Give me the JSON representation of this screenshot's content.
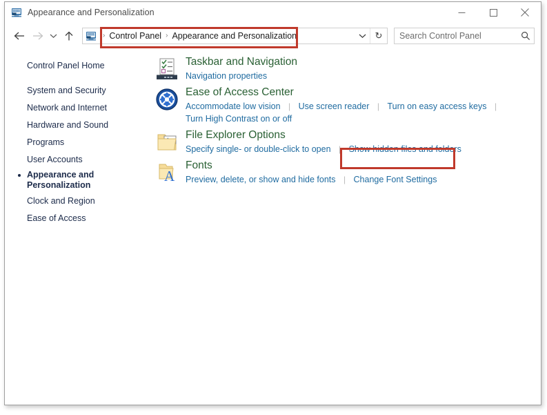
{
  "window": {
    "title": "Appearance and Personalization",
    "title_icon": "control-panel-icon",
    "caption": {
      "minimize": "minimize-icon",
      "maximize": "maximize-icon",
      "close": "close-icon"
    }
  },
  "navbar": {
    "back": "back-arrow-icon",
    "forward": "forward-arrow-icon",
    "recent": "recent-locations-chevron-icon",
    "up": "up-arrow-icon",
    "breadcrumb_icon": "control-panel-icon",
    "breadcrumb": [
      {
        "label": "Control Panel"
      },
      {
        "label": "Appearance and Personalization"
      }
    ],
    "breadcrumb_separator": "›",
    "address_chevron": "chevron-down-icon",
    "refresh": "↻",
    "search_placeholder": "Search Control Panel",
    "search_value": "",
    "search_icon": "magnifier-icon"
  },
  "sidebar": {
    "items": [
      {
        "label": "Control Panel Home",
        "current": false,
        "gap": false
      },
      {
        "label": "System and Security",
        "current": false,
        "gap": true
      },
      {
        "label": "Network and Internet",
        "current": false,
        "gap": false
      },
      {
        "label": "Hardware and Sound",
        "current": false,
        "gap": false
      },
      {
        "label": "Programs",
        "current": false,
        "gap": false
      },
      {
        "label": "User Accounts",
        "current": false,
        "gap": false
      },
      {
        "label": "Appearance and Personalization",
        "current": true,
        "gap": false
      },
      {
        "label": "Clock and Region",
        "current": false,
        "gap": false
      },
      {
        "label": "Ease of Access",
        "current": false,
        "gap": false
      }
    ]
  },
  "main": {
    "categories": [
      {
        "icon": "taskbar-navigation-icon",
        "title": "Taskbar and Navigation",
        "links": [
          {
            "label": "Navigation properties",
            "trailing_separator": false
          }
        ]
      },
      {
        "icon": "ease-of-access-icon",
        "title": "Ease of Access Center",
        "links": [
          {
            "label": "Accommodate low vision",
            "trailing_separator": true
          },
          {
            "label": "Use screen reader",
            "trailing_separator": true
          },
          {
            "label": "Turn on easy access keys",
            "trailing_separator": true
          },
          {
            "label": "Turn High Contrast on or off",
            "trailing_separator": false,
            "newline_before": true
          }
        ]
      },
      {
        "icon": "file-explorer-options-icon",
        "title": "File Explorer Options",
        "links": [
          {
            "label": "Specify single- or double-click to open",
            "trailing_separator": true
          },
          {
            "label": "Show hidden files and folders",
            "trailing_separator": false,
            "highlighted": true
          }
        ]
      },
      {
        "icon": "fonts-icon",
        "title": "Fonts",
        "links": [
          {
            "label": "Preview, delete, or show and hide fonts",
            "trailing_separator": true
          },
          {
            "label": "Change Font Settings",
            "trailing_separator": false
          }
        ]
      }
    ]
  },
  "annotations": {
    "color": "#c0392b",
    "boxes": [
      {
        "name": "breadcrumb-highlight",
        "target": "Control Panel > Appearance and Personalization"
      },
      {
        "name": "show-hidden-files-highlight",
        "target": "Show hidden files and folders"
      }
    ]
  },
  "colors": {
    "heading_green": "#2a6034",
    "link_blue": "#1f6ba0",
    "sidebar_text": "#1c2b4a",
    "annotation_red": "#c0392b"
  }
}
